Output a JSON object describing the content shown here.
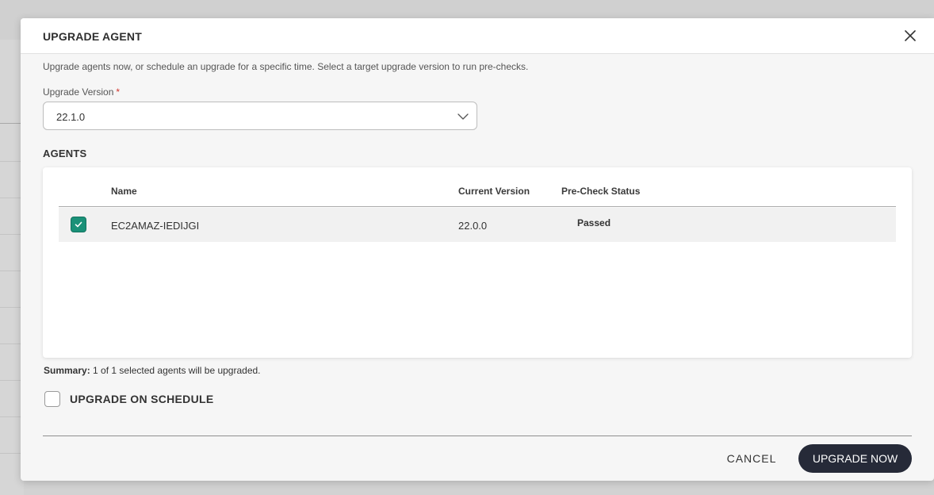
{
  "modal": {
    "title": "UPGRADE AGENT",
    "description": "Upgrade agents now, or schedule an upgrade for a specific time. Select a target upgrade version to run pre-checks.",
    "close_icon": "close-icon"
  },
  "version_field": {
    "label": "Upgrade Version",
    "required_marker": "*",
    "value": "22.1.0",
    "chevron_icon": "chevron-down-icon"
  },
  "agents": {
    "section_title": "AGENTS",
    "columns": {
      "name": "Name",
      "current_version": "Current Version",
      "precheck_status": "Pre-Check Status"
    },
    "rows": [
      {
        "checked": true,
        "name": "EC2AMAZ-IEDIJGI",
        "current_version": "22.0.0",
        "precheck_status": "Passed"
      }
    ]
  },
  "summary": {
    "label": "Summary:",
    "text": "1 of 1 selected agents will be upgraded."
  },
  "schedule": {
    "checked": false,
    "label": "UPGRADE ON SCHEDULE"
  },
  "footer": {
    "cancel_label": "CANCEL",
    "upgrade_label": "UPGRADE NOW"
  },
  "colors": {
    "checkbox_accent": "#1a9178",
    "primary_button": "#262a38",
    "required_marker": "#d0342c"
  }
}
